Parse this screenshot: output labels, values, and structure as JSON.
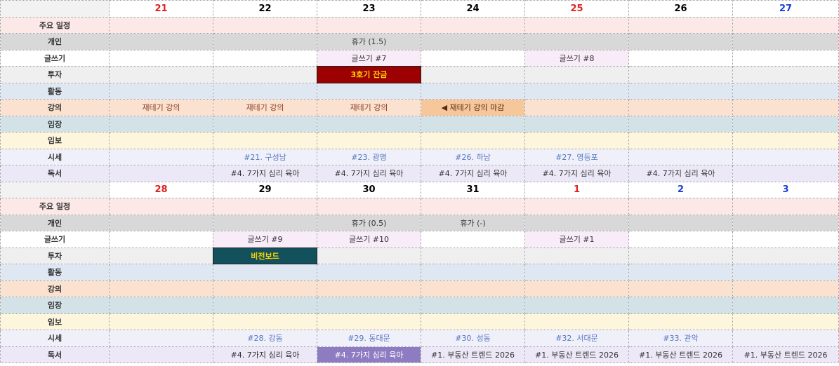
{
  "weeks": [
    {
      "days": [
        "21",
        "22",
        "23",
        "24",
        "25",
        "26",
        "27"
      ],
      "day_colors": [
        "red",
        "black",
        "black",
        "black",
        "red",
        "black",
        "blue"
      ],
      "rows": {
        "main": {
          "label": "주요 일정",
          "cells": [
            "",
            "",
            "",
            "",
            "",
            "",
            ""
          ]
        },
        "personal": {
          "label": "개인",
          "cells": [
            "",
            "",
            "휴가 (1.5)",
            "",
            "",
            "",
            ""
          ]
        },
        "writing": {
          "label": "글쓰기",
          "cells": [
            "",
            "",
            "글쓰기 #7",
            "",
            "글쓰기 #8",
            "",
            ""
          ]
        },
        "invest": {
          "label": "투자",
          "cells": [
            "",
            "",
            "3호기 잔금",
            "",
            "",
            "",
            ""
          ]
        },
        "activity": {
          "label": "활동",
          "cells": [
            "",
            "",
            "",
            "",
            "",
            "",
            ""
          ]
        },
        "lecture": {
          "label": "강의",
          "cells": [
            "재테기 강의",
            "재테기 강의",
            "재테기 강의",
            "◀ 재테기 강의 마감",
            "",
            "",
            ""
          ]
        },
        "visit": {
          "label": "임장",
          "cells": [
            "",
            "",
            "",
            "",
            "",
            "",
            ""
          ]
        },
        "report": {
          "label": "임보",
          "cells": [
            "",
            "",
            "",
            "",
            "",
            "",
            ""
          ]
        },
        "price": {
          "label": "시세",
          "cells": [
            "",
            "#21. 구성남",
            "#23. 광명",
            "#26. 하남",
            "#27. 영등포",
            "",
            ""
          ]
        },
        "reading": {
          "label": "독서",
          "cells": [
            "",
            "#4. 7가지 심리 육아",
            "#4. 7가지 심리 육아",
            "#4. 7가지 심리 육아",
            "#4. 7가지 심리 육아",
            "#4. 7가지 심리 육아",
            ""
          ]
        }
      }
    },
    {
      "days": [
        "28",
        "29",
        "30",
        "31",
        "1",
        "2",
        "3"
      ],
      "day_colors": [
        "red",
        "black",
        "black",
        "black",
        "red",
        "blue",
        "blue"
      ],
      "rows": {
        "main": {
          "label": "주요 일정",
          "cells": [
            "",
            "",
            "",
            "",
            "",
            "",
            ""
          ]
        },
        "personal": {
          "label": "개인",
          "cells": [
            "",
            "",
            "휴가 (0.5)",
            "휴가 (-)",
            "",
            "",
            ""
          ]
        },
        "writing": {
          "label": "글쓰기",
          "cells": [
            "",
            "글쓰기 #9",
            "글쓰기 #10",
            "",
            "글쓰기 #1",
            "",
            ""
          ]
        },
        "invest": {
          "label": "투자",
          "cells": [
            "",
            "비전보드",
            "",
            "",
            "",
            "",
            ""
          ]
        },
        "activity": {
          "label": "활동",
          "cells": [
            "",
            "",
            "",
            "",
            "",
            "",
            ""
          ]
        },
        "lecture": {
          "label": "강의",
          "cells": [
            "",
            "",
            "",
            "",
            "",
            "",
            ""
          ]
        },
        "visit": {
          "label": "임장",
          "cells": [
            "",
            "",
            "",
            "",
            "",
            "",
            ""
          ]
        },
        "report": {
          "label": "임보",
          "cells": [
            "",
            "",
            "",
            "",
            "",
            "",
            ""
          ]
        },
        "price": {
          "label": "시세",
          "cells": [
            "",
            "#28. 강동",
            "#29. 동대문",
            "#30. 성동",
            "#32. 서대문",
            "#33. 관악",
            ""
          ]
        },
        "reading": {
          "label": "독서",
          "cells": [
            "",
            "#4. 7가지 심리 육아",
            "#4. 7가지 심리 육아",
            "#1. 부동산 트렌드 2026",
            "#1. 부동산 트렌드 2026",
            "#1. 부동산 트렌드 2026",
            "#1. 부동산 트렌드 2026"
          ]
        }
      }
    }
  ],
  "colors": {
    "sunday_red": "#e02020",
    "saturday_blue": "#1a3fd6",
    "invest_red_bg": "#9c0000",
    "invest_teal_bg": "#12505c",
    "invest_text": "#ffd400",
    "reading_highlight_bg": "#8e7cc3"
  }
}
